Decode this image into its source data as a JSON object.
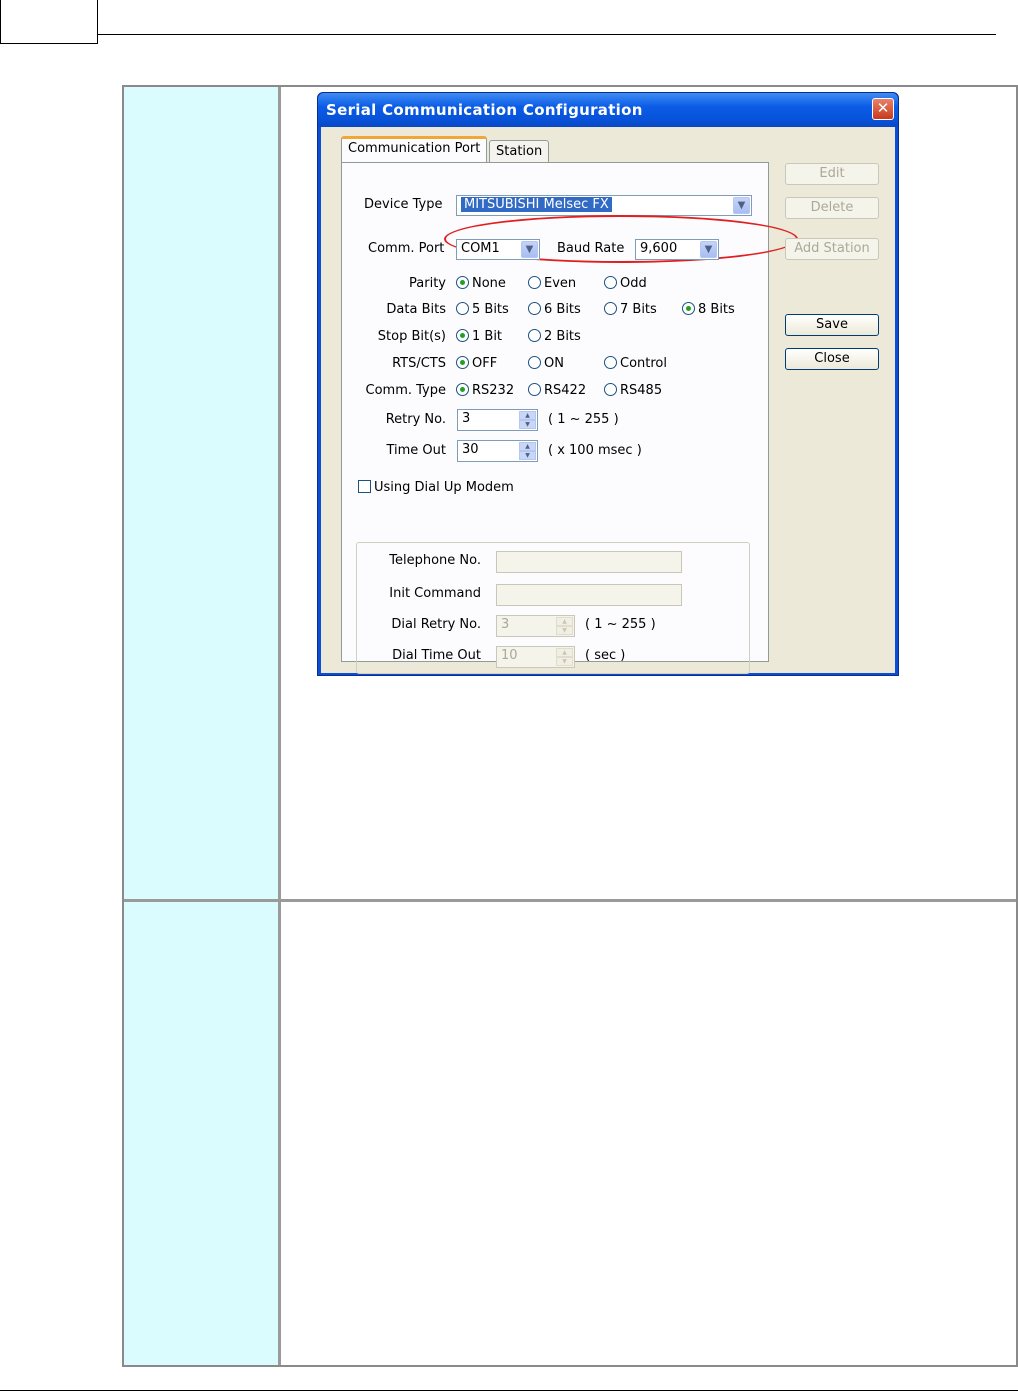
{
  "dialog": {
    "title": "Serial Communication Configuration",
    "close_glyph": "✕",
    "tabs": [
      "Communication Port",
      "Station"
    ],
    "device_type": {
      "label": "Device Type",
      "value": "MITSUBISHI Melsec FX"
    },
    "comm_port": {
      "label": "Comm. Port",
      "value": "COM1"
    },
    "baud_rate": {
      "label": "Baud Rate",
      "value": "9,600"
    },
    "parity": {
      "label": "Parity",
      "options": [
        "None",
        "Even",
        "Odd"
      ],
      "selected": "None"
    },
    "data_bits": {
      "label": "Data Bits",
      "options": [
        "5 Bits",
        "6 Bits",
        "7 Bits",
        "8 Bits"
      ],
      "selected": "8 Bits"
    },
    "stop_bits": {
      "label": "Stop Bit(s)",
      "options": [
        "1 Bit",
        "2 Bits"
      ],
      "selected": "1 Bit"
    },
    "rts_cts": {
      "label": "RTS/CTS",
      "options": [
        "OFF",
        "ON",
        "Control"
      ],
      "selected": "OFF"
    },
    "comm_type": {
      "label": "Comm. Type",
      "options": [
        "RS232",
        "RS422",
        "RS485"
      ],
      "selected": "RS232"
    },
    "retry_no": {
      "label": "Retry No.",
      "value": "3",
      "range": "( 1 ~ 255 )"
    },
    "time_out": {
      "label": "Time Out",
      "value": "30",
      "range": "( x 100 msec )"
    },
    "dial_up": {
      "checkbox_label": "Using Dial Up Modem",
      "checked": false,
      "telephone_label": "Telephone No.",
      "init_label": "Init Command",
      "dial_retry_label": "Dial Retry No.",
      "dial_retry_value": "3",
      "dial_retry_range": "( 1 ~ 255 )",
      "dial_timeout_label": "Dial Time Out",
      "dial_timeout_value": "10",
      "dial_timeout_range": "( sec )"
    },
    "buttons": {
      "edit": "Edit",
      "delete": "Delete",
      "add_station": "Add Station",
      "save": "Save",
      "close": "Close"
    },
    "dropdown_glyph": "▼"
  },
  "colors": {
    "titlebar": "#0b5ce6",
    "panel": "#ece9d8",
    "selection": "#316ac5",
    "highlight_ellipse": "#e02020",
    "table_left_cell": "#dbfcfe"
  }
}
